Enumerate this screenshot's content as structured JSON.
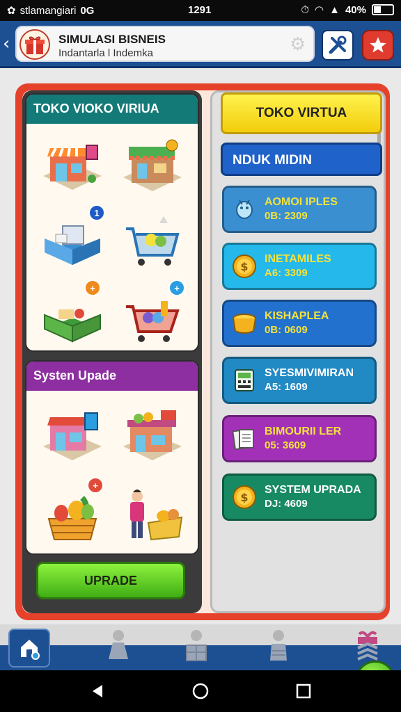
{
  "status_bar": {
    "carrier": "stlamangiari",
    "network": "0G",
    "time": "1291",
    "battery": "40%",
    "battery_level": 0.4
  },
  "header": {
    "back_glyph": "‹",
    "title": "SIMULASI BISNEIS",
    "subtitle": "Indantarla l Indemka",
    "icons": [
      "gift-icon",
      "gear-icon",
      "tools-icon",
      "star-icon"
    ]
  },
  "left_panel": {
    "section1": {
      "title": "TOKO VIOKO VIRIUA",
      "tiles": [
        {
          "icon": "storefront-icon",
          "badge": ""
        },
        {
          "icon": "shop-icon",
          "badge": ""
        },
        {
          "icon": "crate-icon",
          "badge": "1"
        },
        {
          "icon": "shopping-cart-icon",
          "badge": ""
        },
        {
          "icon": "produce-basket-icon",
          "badge": "+"
        },
        {
          "icon": "cart-items-icon",
          "badge": "+"
        }
      ]
    },
    "section2": {
      "title": "Systen Upade",
      "tiles": [
        {
          "icon": "pink-store-icon",
          "badge": ""
        },
        {
          "icon": "market-stall-icon",
          "badge": ""
        },
        {
          "icon": "vegetable-crate-icon",
          "badge": "+"
        },
        {
          "icon": "shopkeeper-icon",
          "badge": ""
        }
      ]
    },
    "upgrade_label": "UPRADE"
  },
  "right_panel": {
    "top_tab": "TOKO VIRTUA",
    "sub_tab": "NDUK MIDIN",
    "cards": [
      {
        "icon": "robot-icon",
        "title": "AOMOI IPLES",
        "value": "0B: 2309",
        "bg": "#3a8fd1",
        "color": "#f3e23d"
      },
      {
        "icon": "coin-icon",
        "title": "INETAMILES",
        "value": "A6: 3309",
        "bg": "#25b8ea",
        "color": "#f3e23d"
      },
      {
        "icon": "pot-icon",
        "title": "KISHAPLEA",
        "value": "0B: 0609",
        "bg": "#2371cf",
        "color": "#f3e23d"
      },
      {
        "icon": "machine-icon",
        "title": "SYESMIVIMIRAN",
        "value": "A5: 1609",
        "bg": "#2189c4",
        "color": "#ffffff"
      },
      {
        "icon": "papers-icon",
        "title": "BIMOURII LER",
        "value": "05: 3609",
        "bg": "#a331b8",
        "color": "#f3e23d"
      },
      {
        "icon": "dollar-coin-icon",
        "title": "SYSTEM UPRADA",
        "value": "DJ: 4609",
        "bg": "#178a64",
        "color": "#ffffff"
      }
    ]
  },
  "bottom_nav": {
    "items": [
      "home-icon",
      "user-icon",
      "store-user-icon",
      "profile-icon",
      "gift-stack-icon"
    ],
    "fab_icon": "location-icon"
  },
  "system_nav": [
    "back-triangle-icon",
    "home-circle-icon",
    "recents-square-icon"
  ]
}
